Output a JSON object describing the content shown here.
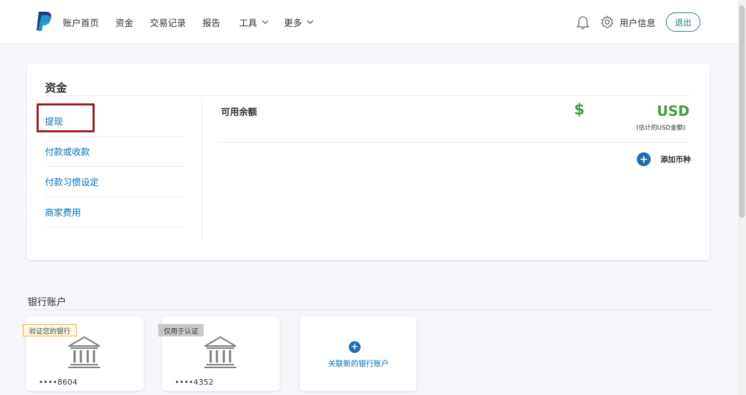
{
  "header": {
    "nav": [
      {
        "label": "账户首页"
      },
      {
        "label": "资金"
      },
      {
        "label": "交易记录"
      },
      {
        "label": "报告"
      },
      {
        "label": "工具"
      },
      {
        "label": "更多"
      }
    ],
    "user_label": "用户信息",
    "logout_label": "退出"
  },
  "funds": {
    "title": "资金",
    "menu": [
      {
        "label": "提现"
      },
      {
        "label": "付款或收款"
      },
      {
        "label": "付款习惯设定"
      },
      {
        "label": "商家费用"
      }
    ],
    "balance_label": "可用余额",
    "currency_symbol": "$",
    "currency_code": "USD",
    "estimate_note": "(估计的USD金额)",
    "add_currency_label": "添加币种"
  },
  "bank": {
    "title": "银行账户",
    "cards": [
      {
        "badge": "验证您的银行",
        "number": "••••8604"
      },
      {
        "badge": "仅用于认证",
        "number": "••••4352"
      }
    ],
    "link_new_label": "关联新的银行账户"
  },
  "colors": {
    "brand_blue": "#0070ba",
    "logout_teal": "#1e7a78",
    "balance_green": "#3e9e3a",
    "highlight_red": "#9b1b1f"
  }
}
